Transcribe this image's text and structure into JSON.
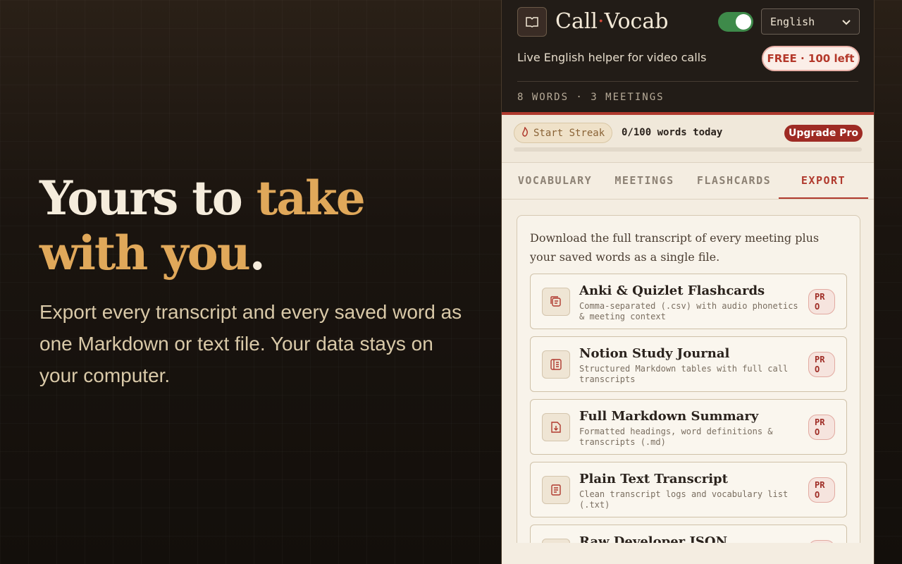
{
  "hero": {
    "line1_plain": "Yours to ",
    "line1_accent": "take",
    "line2_accent": "with you",
    "line2_dot": ".",
    "description": "Export every transcript and every saved word as one Markdown or text file. Your data stays on your computer."
  },
  "header": {
    "brand_part1": "Call",
    "brand_dot": "·",
    "brand_part2": "Vocab",
    "language": "English",
    "subtitle": "Live English helper for video calls",
    "free_badge": "FREE · 100 left",
    "stats": "8 WORDS · 3 MEETINGS"
  },
  "streak": {
    "label": "Start Streak",
    "count": "0/100 words today",
    "upgrade": "Upgrade Pro",
    "progress": 0
  },
  "tabs": [
    "VOCABULARY",
    "MEETINGS",
    "FLASHCARDS",
    "EXPORT"
  ],
  "export": {
    "intro": "Download the full transcript of every meeting plus your saved words as a single file.",
    "options": [
      {
        "title": "Anki & Quizlet Flashcards",
        "desc": "Comma-separated (.csv) with audio phonetics & meeting context",
        "badge_line1": "PR",
        "badge_line2": "O",
        "icon": "cards-icon"
      },
      {
        "title": "Notion Study Journal",
        "desc": "Structured Markdown tables with full call transcripts",
        "badge_line1": "PR",
        "badge_line2": "O",
        "icon": "journal-icon"
      },
      {
        "title": "Full Markdown Summary",
        "desc": "Formatted headings, word definitions & transcripts (.md)",
        "badge_line1": "PR",
        "badge_line2": "O",
        "icon": "download-file-icon"
      },
      {
        "title": "Plain Text Transcript",
        "desc": "Clean transcript logs and vocabulary list (.txt)",
        "badge_line1": "PR",
        "badge_line2": "O",
        "icon": "text-file-icon"
      },
      {
        "title": "Raw Developer JSON",
        "desc": "",
        "badge_line1": "PR",
        "badge_line2": "O",
        "icon": "code-icon"
      }
    ]
  }
}
